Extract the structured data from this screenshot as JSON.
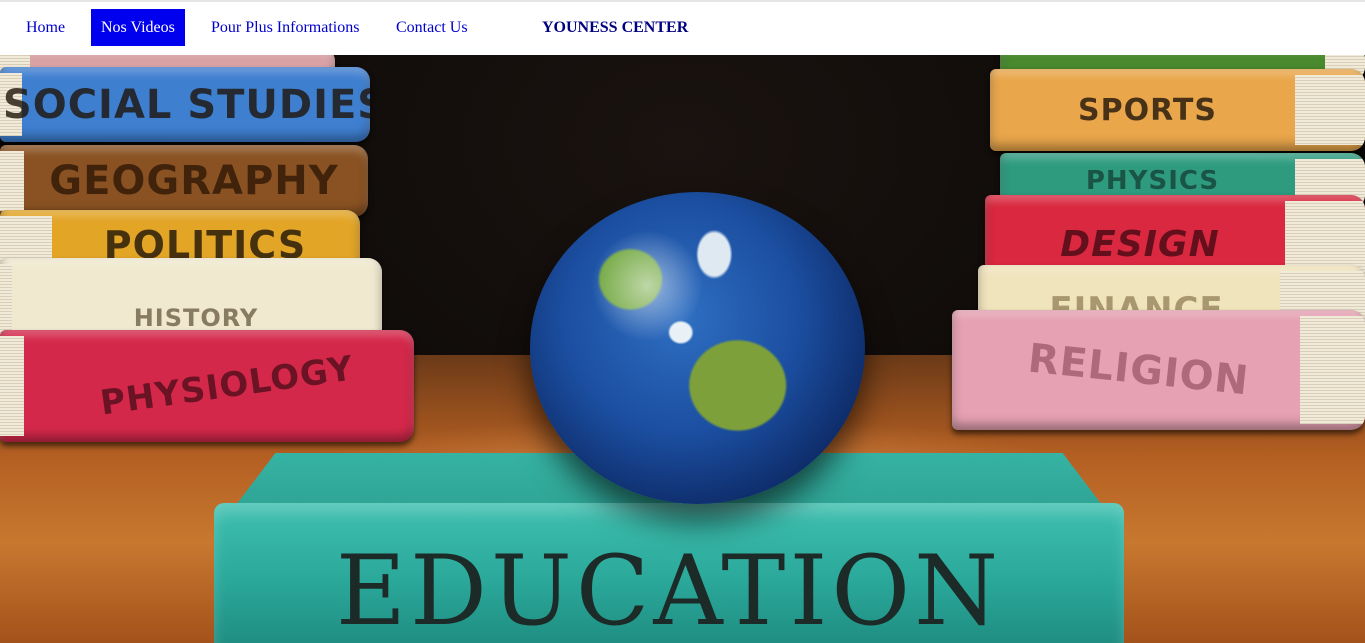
{
  "nav": {
    "items": [
      {
        "label": "Home",
        "active": false
      },
      {
        "label": "Nos Videos",
        "active": true
      },
      {
        "label": "Pour Plus Informations",
        "active": false
      },
      {
        "label": "Contact Us",
        "active": false
      }
    ],
    "brand": "YOUNESS CENTER",
    "active_bg": "#0000ee",
    "link_color": "#0000cc"
  },
  "hero": {
    "left_books": [
      "SOCIAL STUDIES",
      "GEOGRAPHY",
      "POLITICS",
      "HISTORY",
      "PHYSIOLOGY"
    ],
    "right_books": [
      "SPORTS",
      "PHYSICS",
      "DESIGN",
      "FINANCE",
      "RELIGION"
    ],
    "center_book": "EDUCATION",
    "globe_icon": "earth-globe"
  }
}
